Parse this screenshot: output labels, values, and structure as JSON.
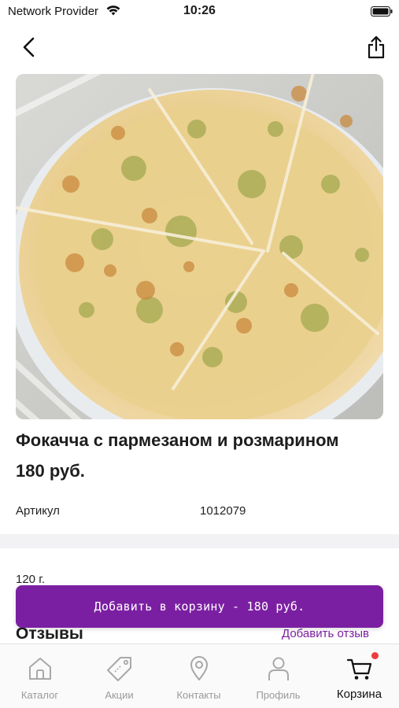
{
  "status_bar": {
    "carrier": "Network Provider",
    "time": "10:26",
    "wifi_icon": "wifi-icon",
    "battery_icon": "battery-icon"
  },
  "nav": {
    "back_icon": "chevron-left-icon",
    "share_icon": "share-icon"
  },
  "product": {
    "image_alt": "pizza-focaccia-image",
    "title": "Фокачча с пармезаном и розмарином",
    "price": "180 руб.",
    "article_label": "Артикул",
    "article_value": "1012079",
    "weight": "120 г."
  },
  "cart_button": {
    "label": "Добавить в корзину - 180 руб."
  },
  "reviews": {
    "title": "Отзывы",
    "add_label": "Добавить отзыв"
  },
  "tabs": [
    {
      "label": "Каталог",
      "icon": "home-icon",
      "active": false
    },
    {
      "label": "Акции",
      "icon": "tag-icon",
      "active": false
    },
    {
      "label": "Контакты",
      "icon": "location-pin-icon",
      "active": false
    },
    {
      "label": "Профиль",
      "icon": "user-icon",
      "active": false
    },
    {
      "label": "Корзина",
      "icon": "cart-icon",
      "active": true
    }
  ],
  "colors": {
    "accent": "#7b1fa2",
    "badge": "#ef3b3b",
    "divider": "#f2f2f5"
  }
}
